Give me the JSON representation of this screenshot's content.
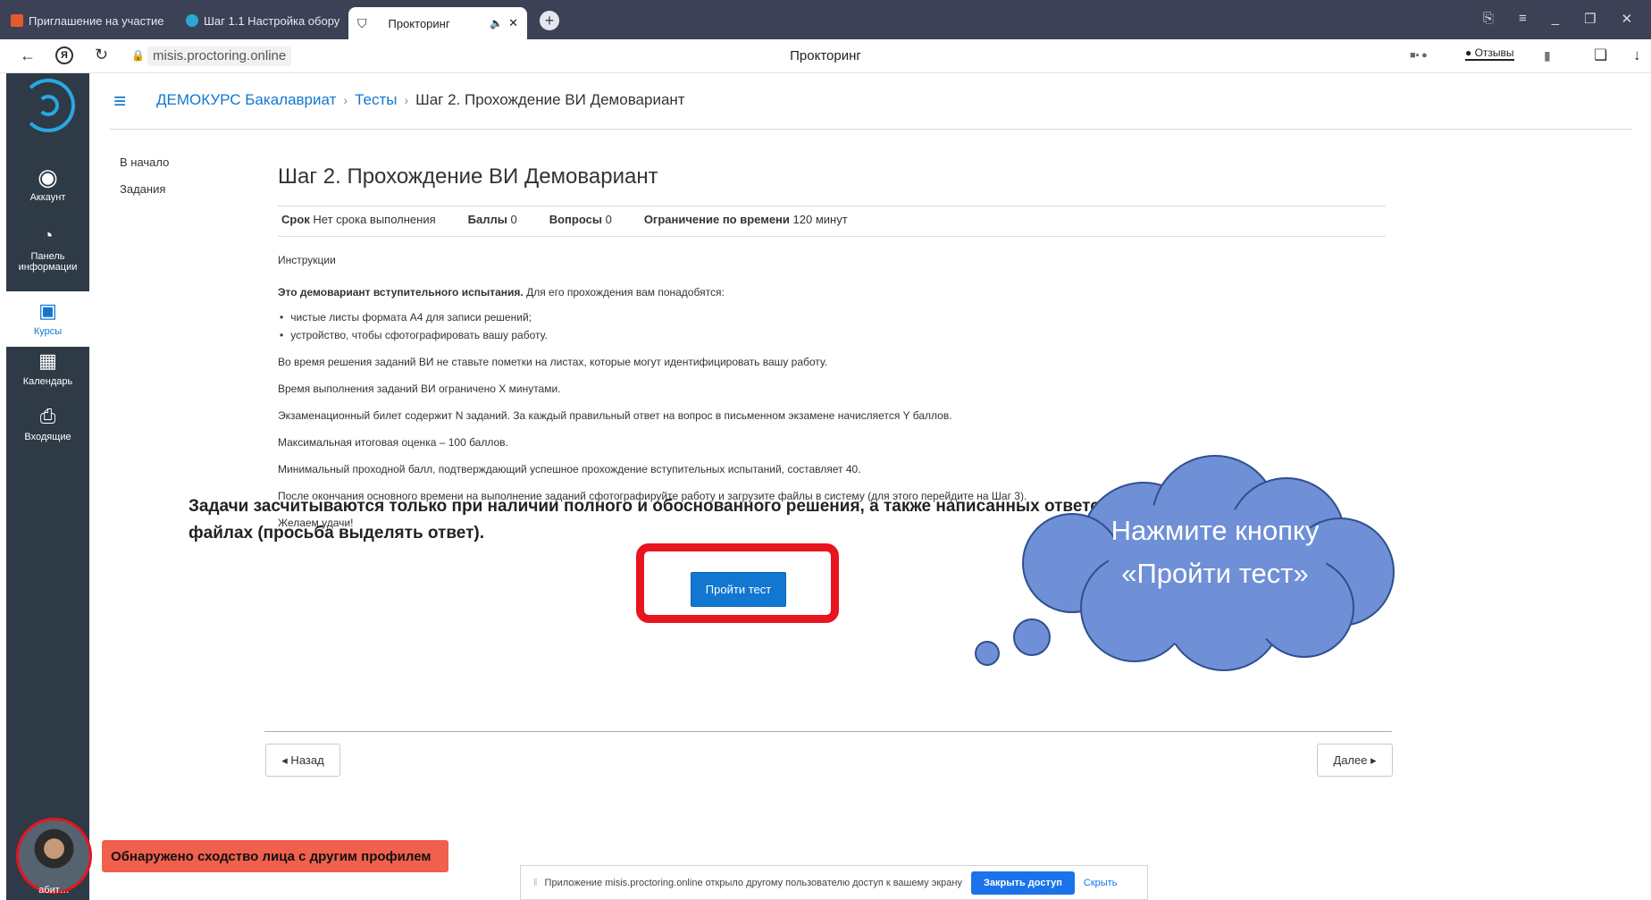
{
  "browser": {
    "tabs": [
      {
        "label": "Приглашение на участие"
      },
      {
        "label": "Шаг 1.1 Настройка обору"
      },
      {
        "label": "Прокторинг"
      }
    ],
    "url": "misis.proctoring.online",
    "page_title": "Прокторинг",
    "feedback_label": "Отзывы"
  },
  "sidebar": {
    "items": [
      {
        "label": "Аккаунт",
        "icon": "user-circle-icon"
      },
      {
        "label": "Панель информации",
        "icon": "dashboard-icon"
      },
      {
        "label": "Курсы",
        "icon": "courses-icon"
      },
      {
        "label": "Календарь",
        "icon": "calendar-icon"
      },
      {
        "label": "Входящие",
        "icon": "inbox-icon"
      }
    ]
  },
  "breadcrumb": [
    "ДЕМОКУРС Бакалавриат",
    "Тесты",
    "Шаг 2. Прохождение ВИ Демовариант"
  ],
  "leftnav": [
    "В начало",
    "Задания"
  ],
  "quiz": {
    "title": "Шаг 2. Прохождение ВИ Демовариант",
    "meta": {
      "due_label": "Срок",
      "due_value": "Нет срока выполнения",
      "points_label": "Баллы",
      "points_value": "0",
      "questions_label": "Вопросы",
      "questions_value": "0",
      "time_label": "Ограничение по времени",
      "time_value": "120 минут"
    },
    "instructions_label": "Инструкции",
    "intro_bold": "Это демовариант вступительного испытания.",
    "intro_rest": " Для его прохождения вам понадобятся:",
    "bullets": [
      "чистые листы формата А4 для записи решений;",
      "устройство, чтобы сфотографировать вашу работу."
    ],
    "paragraphs": [
      " Во время решения заданий ВИ не ставьте пометки на листах, которые могут идентифицировать вашу работу.",
      "Время выполнения заданий ВИ ограничено Х минутами.",
      "Экзаменационный билет содержит N заданий. За каждый правильный ответ на вопрос в письменном экзамене начисляется Y баллов.",
      "Максимальная итоговая оценка – 100 баллов.",
      "Минимальный проходной балл, подтверждающий успешное прохождение вступительных испытаний, составляет 40.",
      "После окончания основного времени на выполнение заданий сфотографируйте работу и загрузите файлы в систему (для этого перейдите на Шаг 3).",
      "Желаем удачи!"
    ],
    "big_notice": "Задачи засчитываются только при наличии полного и обоснованного решения, а также написанных ответов в прикрепленных вами файлах (просьба выделять ответ).",
    "start_button": "Пройти тест",
    "prev_button": "◂ Назад",
    "next_button": "Далее ▸"
  },
  "callout": {
    "line1": "Нажмите кнопку",
    "line2": "«Пройти тест»"
  },
  "proctor_alert": "Обнаружено сходство лица с другим профилем",
  "avatar_caption": "абит…",
  "screen_share": {
    "message": "Приложение misis.proctoring.online открыло другому пользователю доступ к вашему экрану",
    "stop_button": "Закрыть доступ",
    "hide_link": "Скрыть"
  },
  "colors": {
    "accent": "#1177d1",
    "sidebar": "#2e3a46",
    "alert": "#f0604d",
    "highlight": "#e8141e",
    "cloud": "#6f8fd6"
  }
}
